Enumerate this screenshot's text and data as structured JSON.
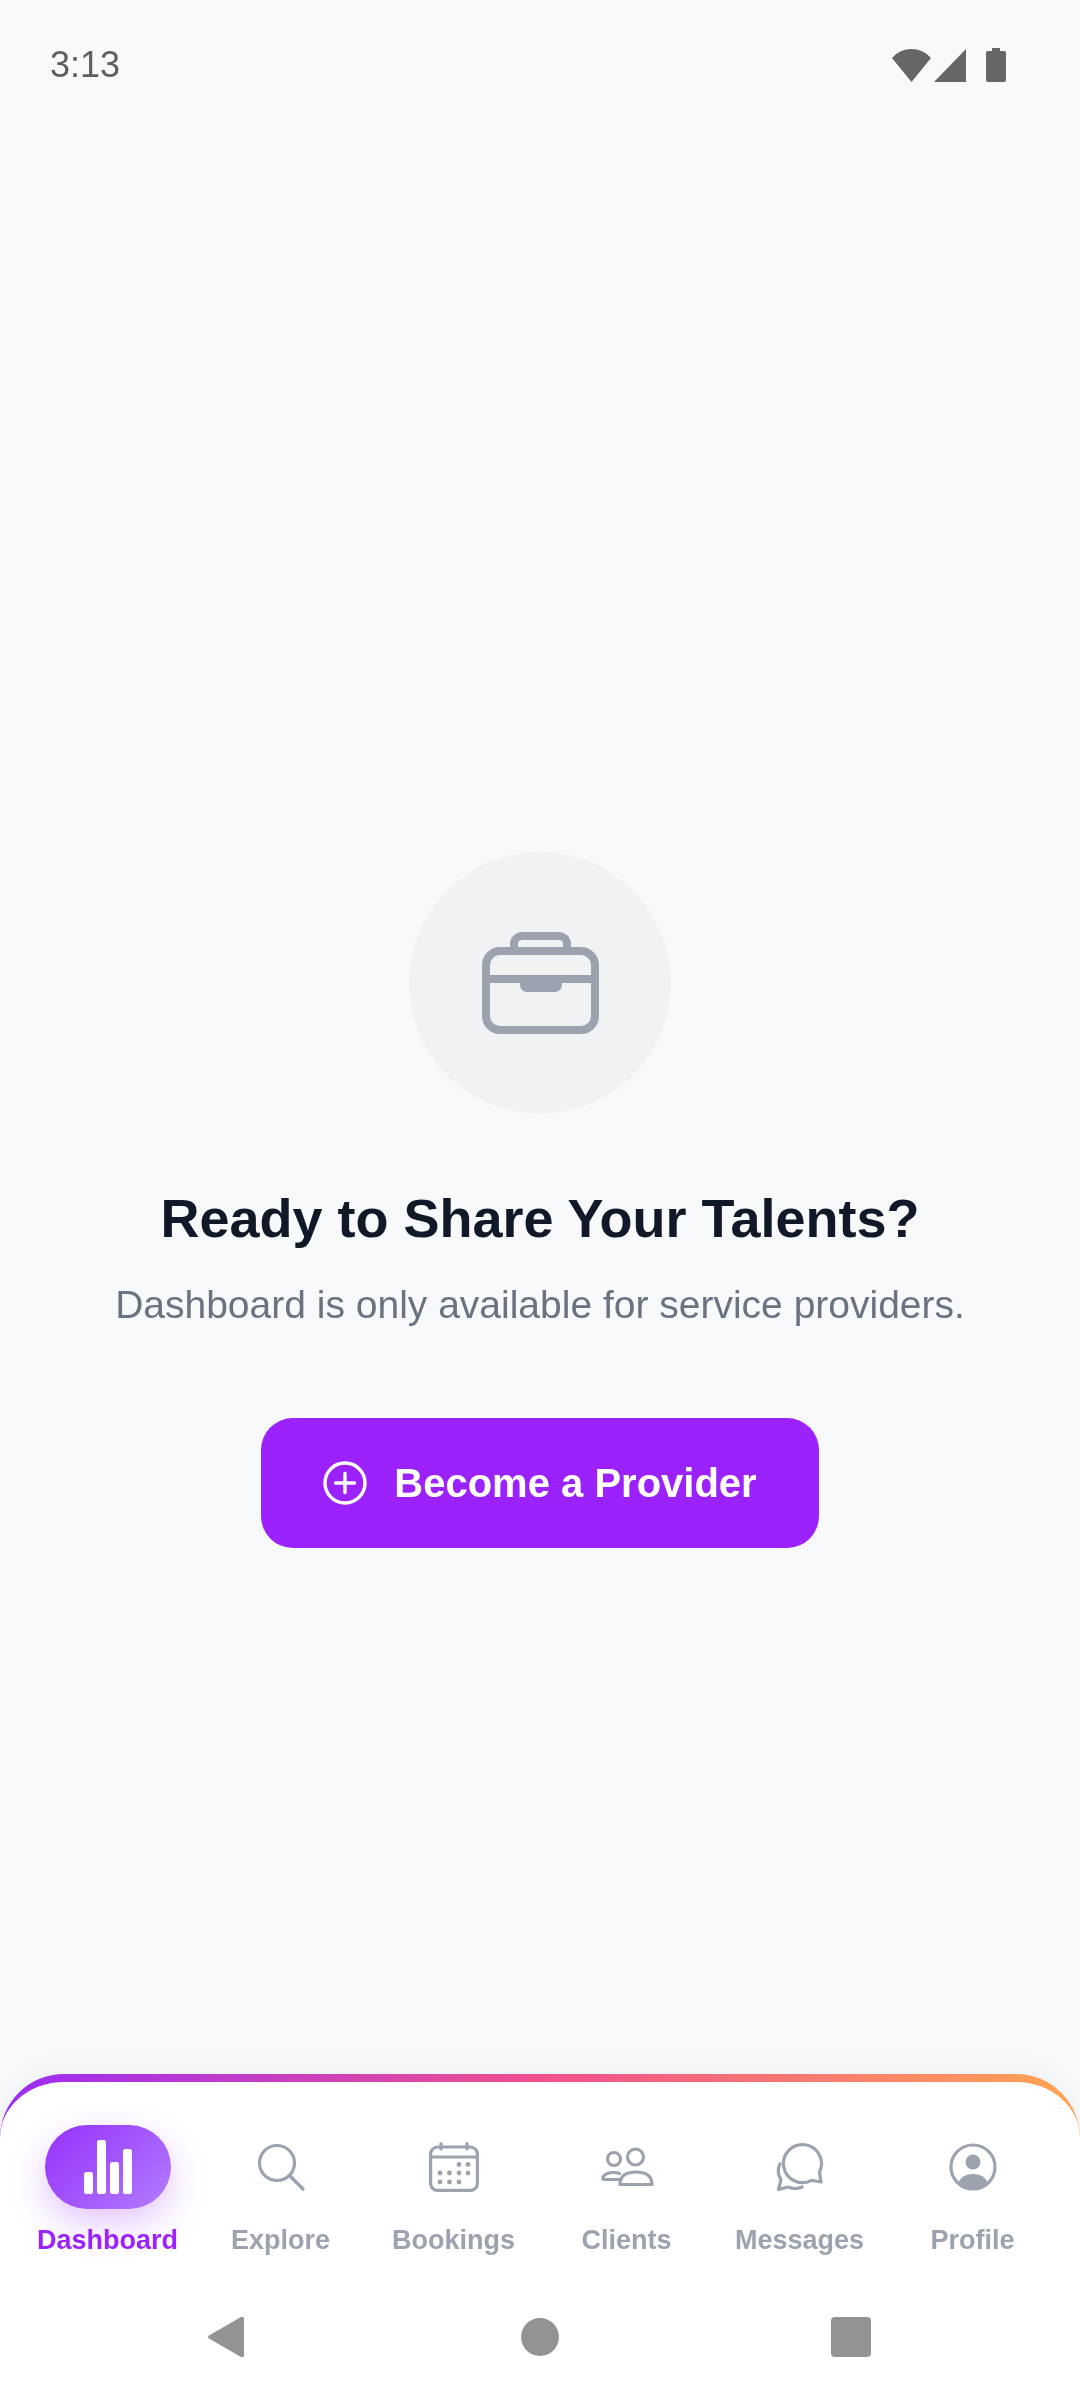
{
  "status_bar": {
    "time": "3:13"
  },
  "empty_state": {
    "title": "Ready to Share Your Talents?",
    "message": "Dashboard is only available for service providers.",
    "action": {
      "label": "Become a Provider"
    }
  },
  "bottom_nav": {
    "items": [
      {
        "label": "Dashboard",
        "selected": true
      },
      {
        "label": "Explore",
        "selected": false
      },
      {
        "label": "Bookings",
        "selected": false
      },
      {
        "label": "Clients",
        "selected": false
      },
      {
        "label": "Messages",
        "selected": false
      },
      {
        "label": "Profile",
        "selected": false
      }
    ]
  }
}
